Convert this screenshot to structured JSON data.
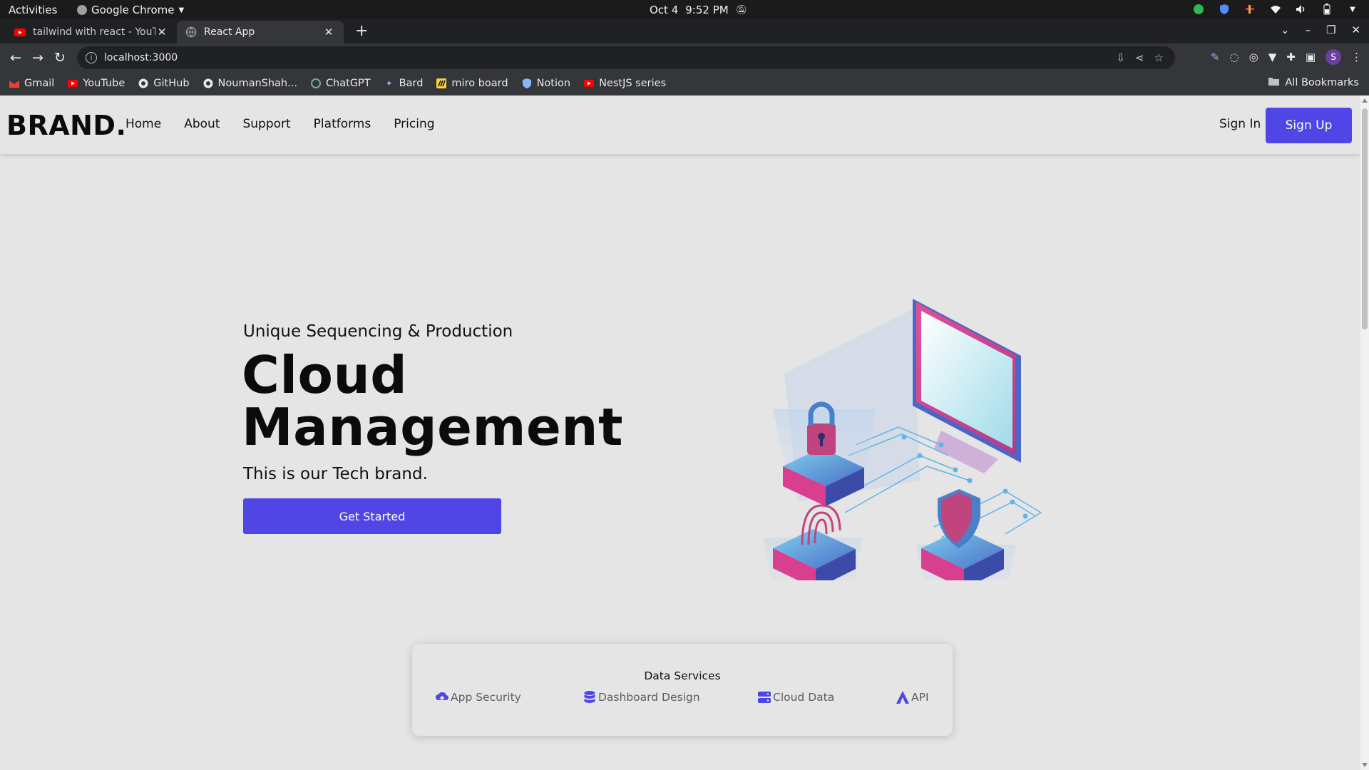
{
  "os": {
    "activities": "Activities",
    "app_name": "Google Chrome",
    "date": "Oct 4",
    "time": "9:52 PM"
  },
  "browser": {
    "tabs": [
      {
        "title": "tailwind with react - YouTube",
        "favicon": "youtube-icon"
      },
      {
        "title": "React App",
        "favicon": "globe-icon"
      }
    ],
    "url": "localhost:3000",
    "bookmarks": [
      {
        "label": "Gmail",
        "icon": "gmail-icon"
      },
      {
        "label": "YouTube",
        "icon": "youtube-icon"
      },
      {
        "label": "GitHub",
        "icon": "github-icon"
      },
      {
        "label": "NoumanShah...",
        "icon": "github-icon"
      },
      {
        "label": "ChatGPT",
        "icon": "chatgpt-icon"
      },
      {
        "label": "Bard",
        "icon": "bard-icon"
      },
      {
        "label": "miro board",
        "icon": "miro-icon"
      },
      {
        "label": "Notion",
        "icon": "shield-icon"
      },
      {
        "label": "NestJS series",
        "icon": "youtube-icon"
      }
    ],
    "all_bookmarks": "All Bookmarks",
    "profile_initial": "S"
  },
  "site": {
    "brand": "BRAND.",
    "nav": [
      "Home",
      "About",
      "Support",
      "Platforms",
      "Pricing"
    ],
    "sign_in": "Sign In",
    "sign_up": "Sign Up",
    "hero": {
      "kicker": "Unique Sequencing & Production",
      "title_line1": "Cloud",
      "title_line2": "Management",
      "subtitle": "This is our Tech brand.",
      "cta": "Get Started"
    },
    "services": {
      "heading": "Data Services",
      "items": [
        {
          "label": "App Security",
          "icon": "cloud-upload-icon"
        },
        {
          "label": "Dashboard Design",
          "icon": "database-icon"
        },
        {
          "label": "Cloud Data",
          "icon": "server-icon"
        },
        {
          "label": "API",
          "icon": "api-icon"
        }
      ]
    }
  },
  "colors": {
    "accent": "#4f46e5",
    "page_bg": "#e5e5e5",
    "chrome_dark": "#202124",
    "chrome_toolbar": "#35363a",
    "os_bar": "#1b1b1b"
  }
}
